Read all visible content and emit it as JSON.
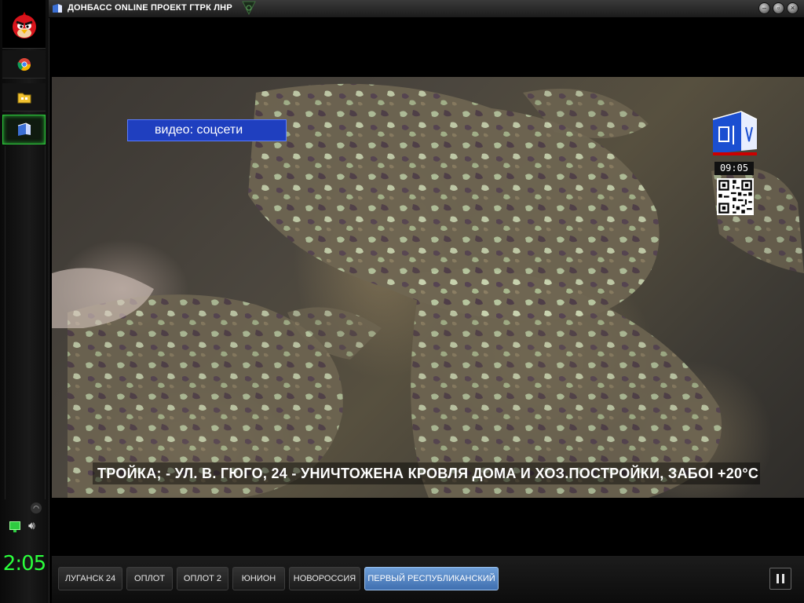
{
  "window": {
    "title": "ДОНБАСС ONLINE ПРОЕКТ ГТРК ЛНР"
  },
  "dock": {
    "apps": [
      {
        "icon": "angry-bird-icon"
      },
      {
        "icon": "chrome-icon"
      },
      {
        "icon": "folder-icon"
      },
      {
        "icon": "tv-app-icon",
        "active": true
      }
    ],
    "clock": "2:05"
  },
  "video": {
    "source_label": "видео: соцсети",
    "channel_time": "09:05",
    "ticker": "ТРОЙКА; - УЛ. В. ГЮГО, 24 - УНИЧТОЖЕНА КРОВЛЯ ДОМА И ХОЗ.ПОСТРОЙКИ, ЗАБОІ +20°С"
  },
  "channels": [
    {
      "label": "ЛУГАНСК 24"
    },
    {
      "label": "ОПЛОТ"
    },
    {
      "label": "ОПЛОТ 2"
    },
    {
      "label": "ЮНИОН"
    },
    {
      "label": "НОВОРОССИЯ"
    },
    {
      "label": "ПЕРВЫЙ РЕСПУБЛИКАНСКИЙ",
      "active": true
    }
  ],
  "colors": {
    "accent_green": "#2bff3c",
    "active_channel": "#4f7fc0",
    "label_blue": "#1f3fbf"
  }
}
